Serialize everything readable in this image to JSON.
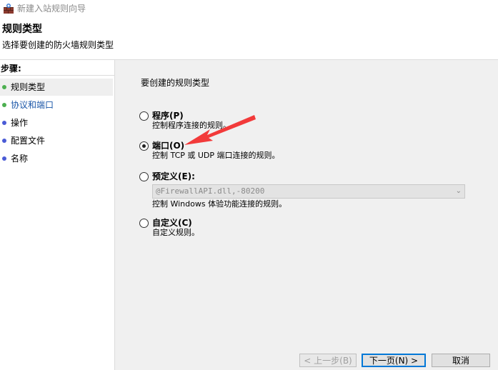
{
  "window": {
    "title": "新建入站规则向导"
  },
  "header": {
    "title": "规则类型",
    "subtitle": "选择要创建的防火墙规则类型"
  },
  "sidebar": {
    "steps_label": "步骤:",
    "items": [
      {
        "label": "规则类型",
        "dot_color": "#4caf50",
        "active": true
      },
      {
        "label": "协议和端口",
        "dot_color": "#4caf50",
        "active": false,
        "text_color": "#1a56a8"
      },
      {
        "label": "操作",
        "dot_color": "#4a5bd6",
        "active": false
      },
      {
        "label": "配置文件",
        "dot_color": "#4a5bd6",
        "active": false
      },
      {
        "label": "名称",
        "dot_color": "#4a5bd6",
        "active": false
      }
    ]
  },
  "main": {
    "heading": "要创建的规则类型",
    "options": [
      {
        "label": "程序(P)",
        "description": "控制程序连接的规则。",
        "checked": false
      },
      {
        "label": "端口(O)",
        "description": "控制 TCP 或 UDP 端口连接的规则。",
        "checked": true
      },
      {
        "label": "预定义(E):",
        "description": "",
        "checked": false
      },
      {
        "label": "自定义(C)",
        "description": "自定义规则。",
        "checked": false
      }
    ],
    "predefined_combo": {
      "value": "@FirewallAPI.dll,-80200"
    },
    "predefined_description": "控制 Windows 体验功能连接的规则。"
  },
  "buttons": {
    "back": "< 上一步(B)",
    "next": "下一页(N) >",
    "cancel": "取消"
  },
  "colors": {
    "annotation_arrow": "#f23a3a",
    "accent": "#0078d7"
  }
}
